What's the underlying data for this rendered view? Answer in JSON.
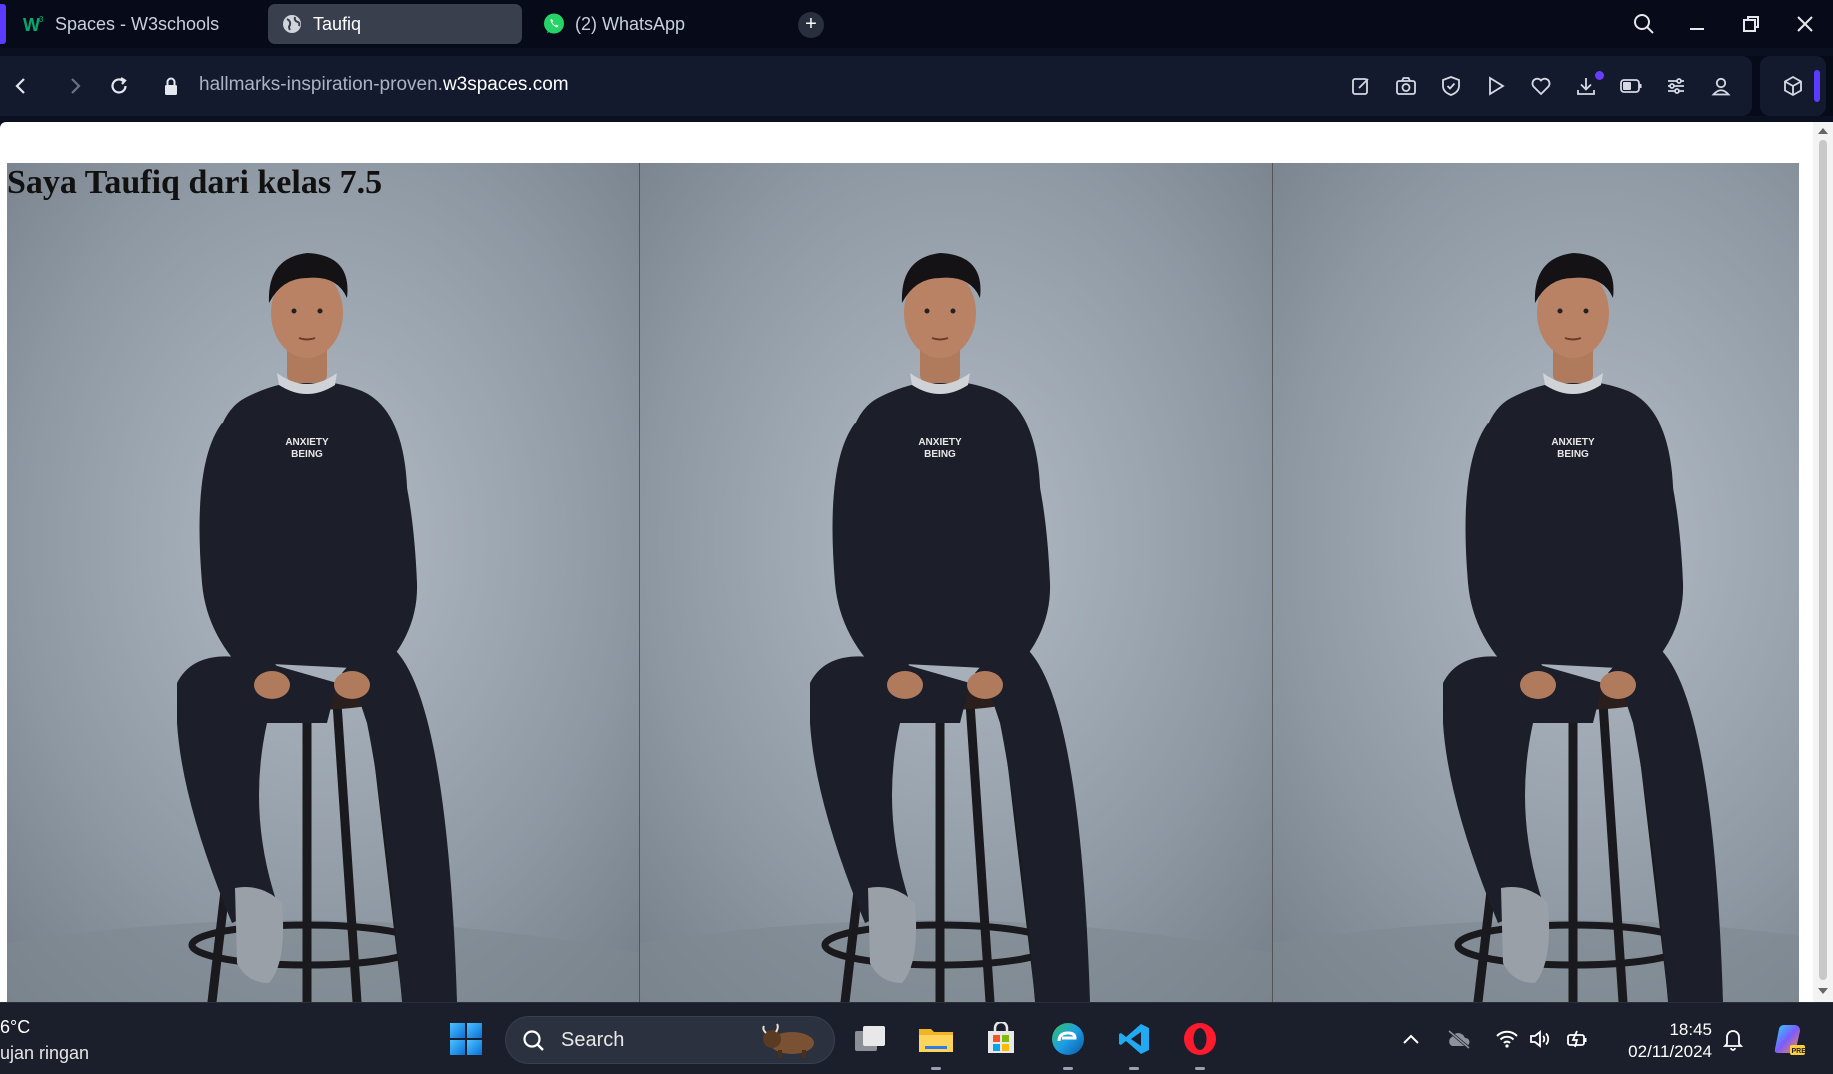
{
  "browser": {
    "tabs": [
      {
        "label": "Spaces - W3schools",
        "icon": "w3schools-icon"
      },
      {
        "label": "Taufiq",
        "icon": "globe-icon",
        "active": true
      },
      {
        "label": "(2) WhatsApp",
        "icon": "whatsapp-icon"
      }
    ],
    "url_prefix": "hallmarks-inspiration-proven.",
    "url_domain": "w3spaces.com"
  },
  "page": {
    "heading": "Saya Taufiq dari kelas 7.5",
    "photo_text": "ANXIETY BEING",
    "photo_count": 3
  },
  "taskbar": {
    "weather_temp": "6°C",
    "weather_desc": "ujan ringan",
    "search_label": "Search",
    "time": "18:45",
    "date": "02/11/2024"
  },
  "colors": {
    "browser_bg": "#070b19",
    "accent": "#5b3bff",
    "photo_backdrop": "#8e98a3",
    "sweater": "#1c1f2a"
  }
}
